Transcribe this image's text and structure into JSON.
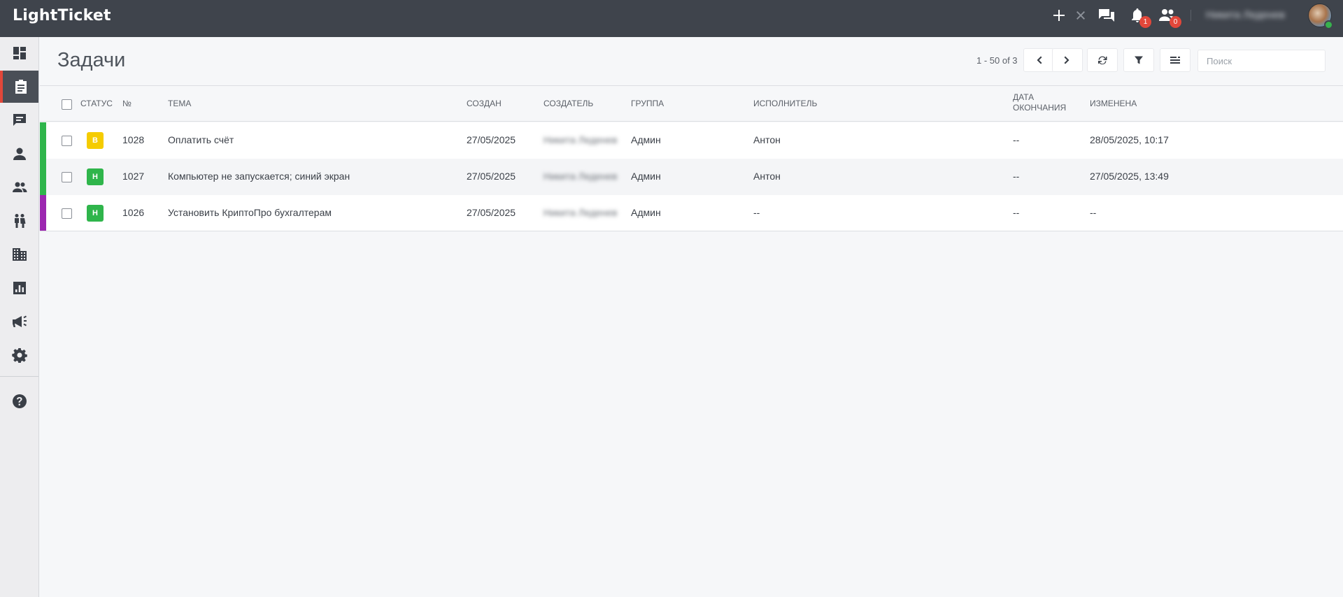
{
  "app": {
    "logo": "LightTicket"
  },
  "topbar": {
    "notifications_count": "1",
    "users_count": "0",
    "user_name": "Никита Леденев"
  },
  "page": {
    "title": "Задачи",
    "pager": "1 - 50 of 3",
    "search_placeholder": "Поиск"
  },
  "table": {
    "columns": {
      "status": "СТАТУС",
      "number": "№",
      "subject": "ТЕМА",
      "created": "СОЗДАН",
      "creator": "СОЗДАТЕЛЬ",
      "group": "ГРУППА",
      "assignee": "ИСПОЛНИТЕЛЬ",
      "due_date": "ДАТА ОКОНЧАНИЯ",
      "modified": "ИЗМЕНЕНА"
    },
    "rows": [
      {
        "priority": "В",
        "priority_color": "#f5cc00",
        "status_color": "#2fb54b",
        "number": "1028",
        "subject": "Оплатить счёт",
        "created": "27/05/2025",
        "creator": "Никита Леденев",
        "group": "Админ",
        "assignee": "Антон",
        "due_date": "--",
        "modified": "28/05/2025, 10:17"
      },
      {
        "priority": "Н",
        "priority_color": "#2fb54b",
        "status_color": "#2fb54b",
        "number": "1027",
        "subject": "Компьютер не запускается; синий экран",
        "created": "27/05/2025",
        "creator": "Никита Леденев",
        "group": "Админ",
        "assignee": "Антон",
        "due_date": "--",
        "modified": "27/05/2025, 13:49"
      },
      {
        "priority": "Н",
        "priority_color": "#2fb54b",
        "status_color": "#9c27b0",
        "number": "1026",
        "subject": "Установить КриптоПро бухгалтерам",
        "created": "27/05/2025",
        "creator": "Никита Леденев",
        "group": "Админ",
        "assignee": "--",
        "due_date": "--",
        "modified": "--"
      }
    ]
  },
  "sidebar": {
    "items": [
      {
        "icon": "dashboard-icon"
      },
      {
        "icon": "tasks-icon",
        "active": true
      },
      {
        "icon": "chat-icon"
      },
      {
        "icon": "person-icon"
      },
      {
        "icon": "users-icon"
      },
      {
        "icon": "people-icon"
      },
      {
        "icon": "building-icon"
      },
      {
        "icon": "reports-icon"
      },
      {
        "icon": "megaphone-icon"
      },
      {
        "icon": "settings-icon"
      },
      {
        "icon": "help-icon"
      }
    ]
  }
}
